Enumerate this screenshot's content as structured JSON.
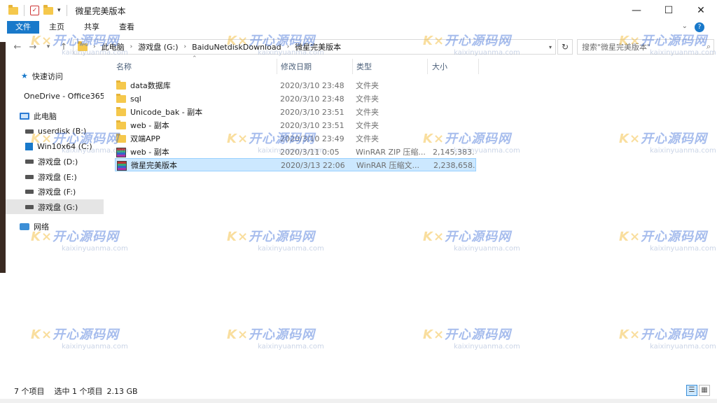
{
  "window": {
    "title": "微星完美版本",
    "controls": {
      "minimize": "—",
      "maximize": "☐",
      "close": "✕"
    }
  },
  "ribbon": {
    "tabs": [
      "文件",
      "主页",
      "共享",
      "查看"
    ],
    "expand": "⌄",
    "help": "?"
  },
  "address": {
    "segments": [
      "此电脑",
      "游戏盘 (G:)",
      "BaiduNetdiskDownload",
      "微星完美版本"
    ],
    "search_placeholder": "搜索\"微星完美版本\""
  },
  "nav": {
    "items": [
      {
        "label": "快速访问",
        "icon": "star-icon"
      },
      {
        "label": "OneDrive - Office365",
        "icon": "cloud-icon"
      },
      {
        "label": "此电脑",
        "icon": "computer-icon"
      },
      {
        "label": "userdisk (B:)",
        "icon": "drive-icon"
      },
      {
        "label": "Win10x64 (C:)",
        "icon": "windows-drive-icon"
      },
      {
        "label": "游戏盘 (D:)",
        "icon": "drive-icon"
      },
      {
        "label": "游戏盘 (E:)",
        "icon": "drive-icon"
      },
      {
        "label": "游戏盘 (F:)",
        "icon": "drive-icon"
      },
      {
        "label": "游戏盘 (G:)",
        "icon": "drive-icon",
        "selected": true
      },
      {
        "label": "网络",
        "icon": "network-icon"
      }
    ]
  },
  "columns": {
    "name": "名称",
    "date": "修改日期",
    "type": "类型",
    "size": "大小"
  },
  "files": [
    {
      "name": "data数据库",
      "date": "2020/3/10 23:48",
      "type": "文件夹",
      "size": "",
      "icon": "folder-icon"
    },
    {
      "name": "sql",
      "date": "2020/3/10 23:48",
      "type": "文件夹",
      "size": "",
      "icon": "folder-icon"
    },
    {
      "name": "Unicode_bak - 副本",
      "date": "2020/3/10 23:51",
      "type": "文件夹",
      "size": "",
      "icon": "folder-icon"
    },
    {
      "name": "web - 副本",
      "date": "2020/3/10 23:51",
      "type": "文件夹",
      "size": "",
      "icon": "folder-icon"
    },
    {
      "name": "双端APP",
      "date": "2020/3/10 23:49",
      "type": "文件夹",
      "size": "",
      "icon": "folder-icon"
    },
    {
      "name": "web - 副本",
      "date": "2020/3/11 0:05",
      "type": "WinRAR ZIP 压缩...",
      "size": "2,145,383...",
      "icon": "winrar-icon"
    },
    {
      "name": "微星完美版本",
      "date": "2020/3/13 22:06",
      "type": "WinRAR 压缩文...",
      "size": "2,238,658...",
      "icon": "winrar-icon",
      "selected": true
    }
  ],
  "status": {
    "count": "7 个项目",
    "selected": "选中 1 个项目",
    "size": "2.13 GB"
  },
  "watermark": {
    "brand": "开心源码网",
    "prefix": "K×",
    "url": "kaixinyuanma.com"
  }
}
